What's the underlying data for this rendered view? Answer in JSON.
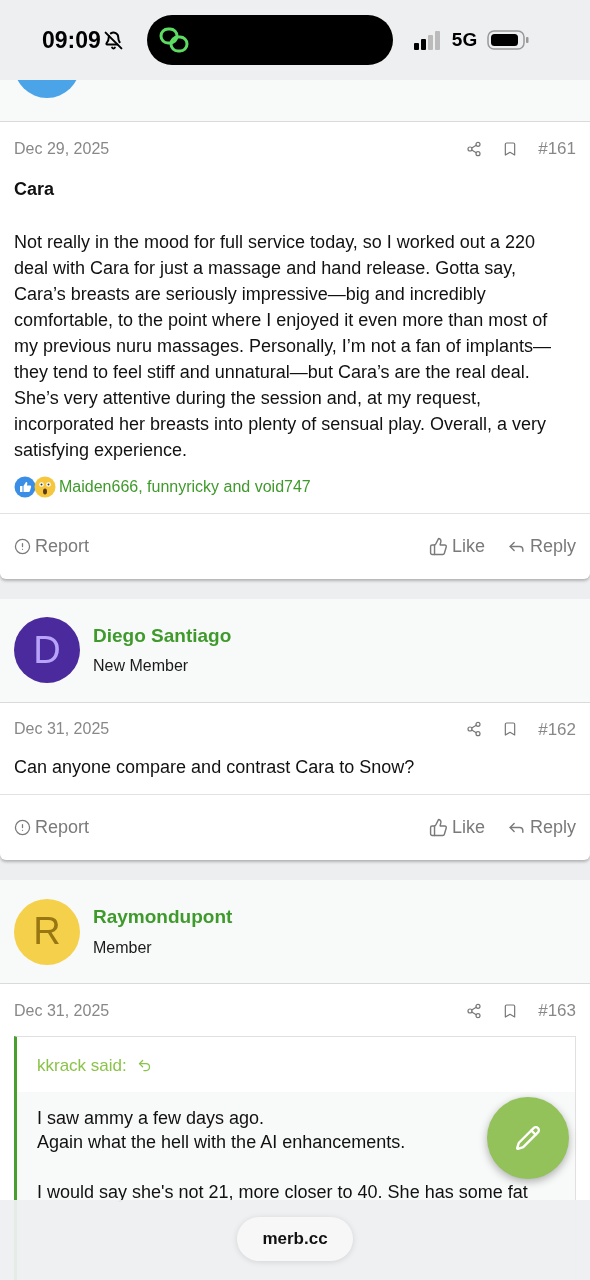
{
  "status_bar": {
    "time": "09:09",
    "network": "5G"
  },
  "posts": [
    {
      "author": {
        "kind": "cut",
        "color": "#4ba3e8"
      },
      "date": "Dec 29, 2025",
      "number": "#161",
      "title": "Cara",
      "body": "Not really in the mood for full service today, so I worked out a 220 deal with Cara for just a massage and hand release. Gotta say, Cara’s breasts are seriously impressive—big and incredibly comfortable, to the point where I enjoyed it even more than most of my previous nuru massages. Personally, I’m not a fan of implants—they tend to feel stiff and unnatural—but Cara’s are the real deal. She’s very attentive during the session and, at my request, incorporated her breasts into plenty of sensual play. Overall, a very satisfying experience.",
      "reactions": "Maiden666, funnyricky and void747",
      "actions": [
        "Report",
        "Like",
        "Reply"
      ]
    },
    {
      "author": {
        "kind": "full",
        "name": "Diego Santiago",
        "role": "New Member",
        "avatar_letter": "D",
        "color": "#4a2a9c"
      },
      "date": "Dec 31, 2025",
      "number": "#162",
      "body": "Can anyone compare and contrast Cara to Snow?",
      "actions": [
        "Report",
        "Like",
        "Reply"
      ]
    },
    {
      "author": {
        "kind": "full",
        "name": "Raymondupont",
        "role": "Member",
        "avatar_letter": "R",
        "color": "#f5d04a"
      },
      "date": "Dec 31, 2025",
      "number": "#163",
      "quote": {
        "author": "kkrack said:",
        "paragraphs": [
          "I saw ammy a few days ago.\nAgain what the hell with the AI enhancements.",
          "I would say she's not 21, more closer to 40. She has some fat"
        ]
      }
    }
  ],
  "browser": {
    "url": "merb.cc"
  }
}
